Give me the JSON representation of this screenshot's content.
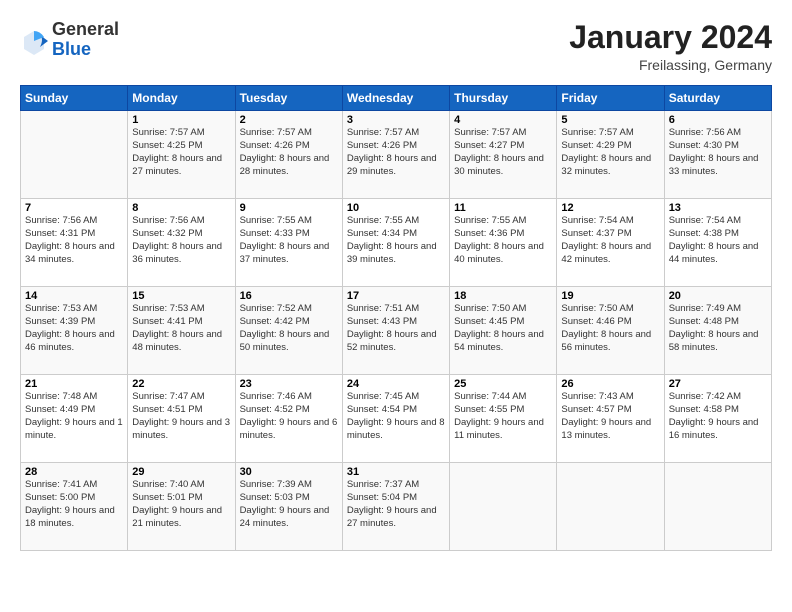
{
  "header": {
    "logo": {
      "general": "General",
      "blue": "Blue"
    },
    "title": "January 2024",
    "location": "Freilassing, Germany"
  },
  "weekdays": [
    "Sunday",
    "Monday",
    "Tuesday",
    "Wednesday",
    "Thursday",
    "Friday",
    "Saturday"
  ],
  "weeks": [
    [
      {
        "day": "",
        "sunrise": "",
        "sunset": "",
        "daylight": ""
      },
      {
        "day": "1",
        "sunrise": "Sunrise: 7:57 AM",
        "sunset": "Sunset: 4:25 PM",
        "daylight": "Daylight: 8 hours and 27 minutes."
      },
      {
        "day": "2",
        "sunrise": "Sunrise: 7:57 AM",
        "sunset": "Sunset: 4:26 PM",
        "daylight": "Daylight: 8 hours and 28 minutes."
      },
      {
        "day": "3",
        "sunrise": "Sunrise: 7:57 AM",
        "sunset": "Sunset: 4:26 PM",
        "daylight": "Daylight: 8 hours and 29 minutes."
      },
      {
        "day": "4",
        "sunrise": "Sunrise: 7:57 AM",
        "sunset": "Sunset: 4:27 PM",
        "daylight": "Daylight: 8 hours and 30 minutes."
      },
      {
        "day": "5",
        "sunrise": "Sunrise: 7:57 AM",
        "sunset": "Sunset: 4:29 PM",
        "daylight": "Daylight: 8 hours and 32 minutes."
      },
      {
        "day": "6",
        "sunrise": "Sunrise: 7:56 AM",
        "sunset": "Sunset: 4:30 PM",
        "daylight": "Daylight: 8 hours and 33 minutes."
      }
    ],
    [
      {
        "day": "7",
        "sunrise": "Sunrise: 7:56 AM",
        "sunset": "Sunset: 4:31 PM",
        "daylight": "Daylight: 8 hours and 34 minutes."
      },
      {
        "day": "8",
        "sunrise": "Sunrise: 7:56 AM",
        "sunset": "Sunset: 4:32 PM",
        "daylight": "Daylight: 8 hours and 36 minutes."
      },
      {
        "day": "9",
        "sunrise": "Sunrise: 7:55 AM",
        "sunset": "Sunset: 4:33 PM",
        "daylight": "Daylight: 8 hours and 37 minutes."
      },
      {
        "day": "10",
        "sunrise": "Sunrise: 7:55 AM",
        "sunset": "Sunset: 4:34 PM",
        "daylight": "Daylight: 8 hours and 39 minutes."
      },
      {
        "day": "11",
        "sunrise": "Sunrise: 7:55 AM",
        "sunset": "Sunset: 4:36 PM",
        "daylight": "Daylight: 8 hours and 40 minutes."
      },
      {
        "day": "12",
        "sunrise": "Sunrise: 7:54 AM",
        "sunset": "Sunset: 4:37 PM",
        "daylight": "Daylight: 8 hours and 42 minutes."
      },
      {
        "day": "13",
        "sunrise": "Sunrise: 7:54 AM",
        "sunset": "Sunset: 4:38 PM",
        "daylight": "Daylight: 8 hours and 44 minutes."
      }
    ],
    [
      {
        "day": "14",
        "sunrise": "Sunrise: 7:53 AM",
        "sunset": "Sunset: 4:39 PM",
        "daylight": "Daylight: 8 hours and 46 minutes."
      },
      {
        "day": "15",
        "sunrise": "Sunrise: 7:53 AM",
        "sunset": "Sunset: 4:41 PM",
        "daylight": "Daylight: 8 hours and 48 minutes."
      },
      {
        "day": "16",
        "sunrise": "Sunrise: 7:52 AM",
        "sunset": "Sunset: 4:42 PM",
        "daylight": "Daylight: 8 hours and 50 minutes."
      },
      {
        "day": "17",
        "sunrise": "Sunrise: 7:51 AM",
        "sunset": "Sunset: 4:43 PM",
        "daylight": "Daylight: 8 hours and 52 minutes."
      },
      {
        "day": "18",
        "sunrise": "Sunrise: 7:50 AM",
        "sunset": "Sunset: 4:45 PM",
        "daylight": "Daylight: 8 hours and 54 minutes."
      },
      {
        "day": "19",
        "sunrise": "Sunrise: 7:50 AM",
        "sunset": "Sunset: 4:46 PM",
        "daylight": "Daylight: 8 hours and 56 minutes."
      },
      {
        "day": "20",
        "sunrise": "Sunrise: 7:49 AM",
        "sunset": "Sunset: 4:48 PM",
        "daylight": "Daylight: 8 hours and 58 minutes."
      }
    ],
    [
      {
        "day": "21",
        "sunrise": "Sunrise: 7:48 AM",
        "sunset": "Sunset: 4:49 PM",
        "daylight": "Daylight: 9 hours and 1 minute."
      },
      {
        "day": "22",
        "sunrise": "Sunrise: 7:47 AM",
        "sunset": "Sunset: 4:51 PM",
        "daylight": "Daylight: 9 hours and 3 minutes."
      },
      {
        "day": "23",
        "sunrise": "Sunrise: 7:46 AM",
        "sunset": "Sunset: 4:52 PM",
        "daylight": "Daylight: 9 hours and 6 minutes."
      },
      {
        "day": "24",
        "sunrise": "Sunrise: 7:45 AM",
        "sunset": "Sunset: 4:54 PM",
        "daylight": "Daylight: 9 hours and 8 minutes."
      },
      {
        "day": "25",
        "sunrise": "Sunrise: 7:44 AM",
        "sunset": "Sunset: 4:55 PM",
        "daylight": "Daylight: 9 hours and 11 minutes."
      },
      {
        "day": "26",
        "sunrise": "Sunrise: 7:43 AM",
        "sunset": "Sunset: 4:57 PM",
        "daylight": "Daylight: 9 hours and 13 minutes."
      },
      {
        "day": "27",
        "sunrise": "Sunrise: 7:42 AM",
        "sunset": "Sunset: 4:58 PM",
        "daylight": "Daylight: 9 hours and 16 minutes."
      }
    ],
    [
      {
        "day": "28",
        "sunrise": "Sunrise: 7:41 AM",
        "sunset": "Sunset: 5:00 PM",
        "daylight": "Daylight: 9 hours and 18 minutes."
      },
      {
        "day": "29",
        "sunrise": "Sunrise: 7:40 AM",
        "sunset": "Sunset: 5:01 PM",
        "daylight": "Daylight: 9 hours and 21 minutes."
      },
      {
        "day": "30",
        "sunrise": "Sunrise: 7:39 AM",
        "sunset": "Sunset: 5:03 PM",
        "daylight": "Daylight: 9 hours and 24 minutes."
      },
      {
        "day": "31",
        "sunrise": "Sunrise: 7:37 AM",
        "sunset": "Sunset: 5:04 PM",
        "daylight": "Daylight: 9 hours and 27 minutes."
      },
      {
        "day": "",
        "sunrise": "",
        "sunset": "",
        "daylight": ""
      },
      {
        "day": "",
        "sunrise": "",
        "sunset": "",
        "daylight": ""
      },
      {
        "day": "",
        "sunrise": "",
        "sunset": "",
        "daylight": ""
      }
    ]
  ]
}
